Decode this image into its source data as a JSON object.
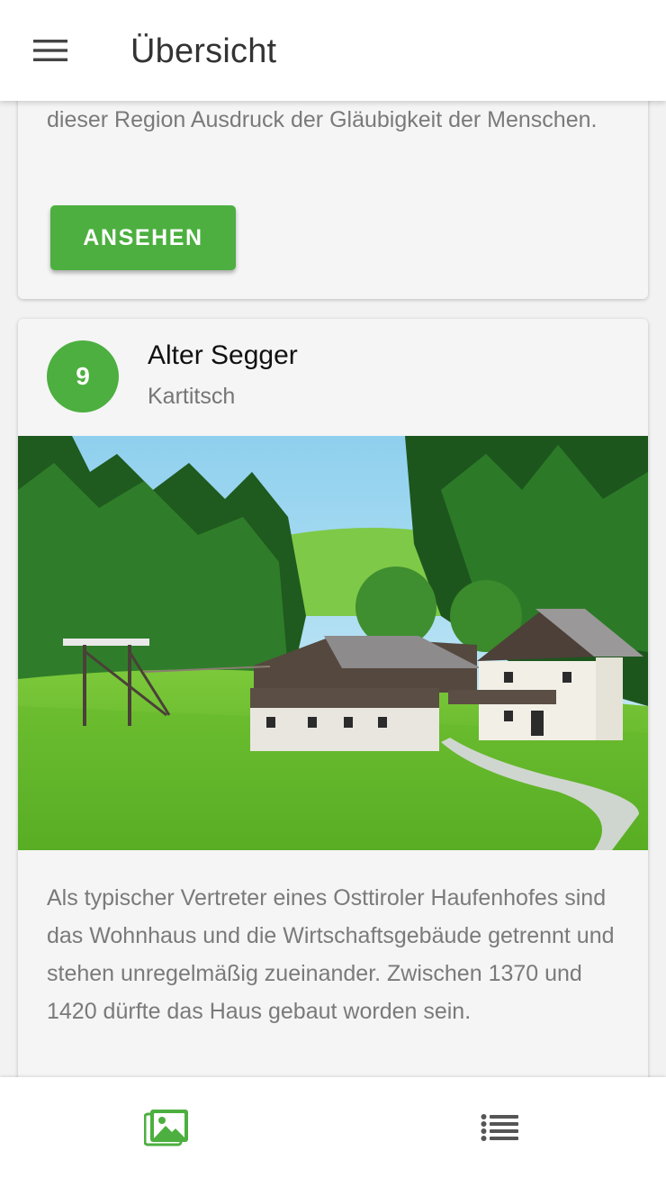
{
  "appbar": {
    "title": "Übersicht",
    "menu_icon": "hamburger-menu-icon"
  },
  "previous_card": {
    "description": "dieser Region Ausdruck der Gläubigkeit der Menschen.",
    "button_label": "ANSEHEN"
  },
  "station": {
    "number": "9",
    "title": "Alter Segger",
    "location": "Kartitsch",
    "image_icon": "farmhouse-photo",
    "description": "Als typischer Vertreter eines Osttiroler Haufenhofes sind das Wohnhaus und die Wirtschaftsgebäude getrennt und stehen unregelmäßig zueinander. Zwischen 1370 und 1420 dürfte das Haus gebaut worden sein."
  },
  "bottom_nav": {
    "tabs": [
      {
        "icon": "gallery-icon",
        "active": true
      },
      {
        "icon": "list-icon",
        "active": false
      }
    ]
  },
  "colors": {
    "accent": "#4caf3f",
    "inactive_icon": "#555555"
  }
}
